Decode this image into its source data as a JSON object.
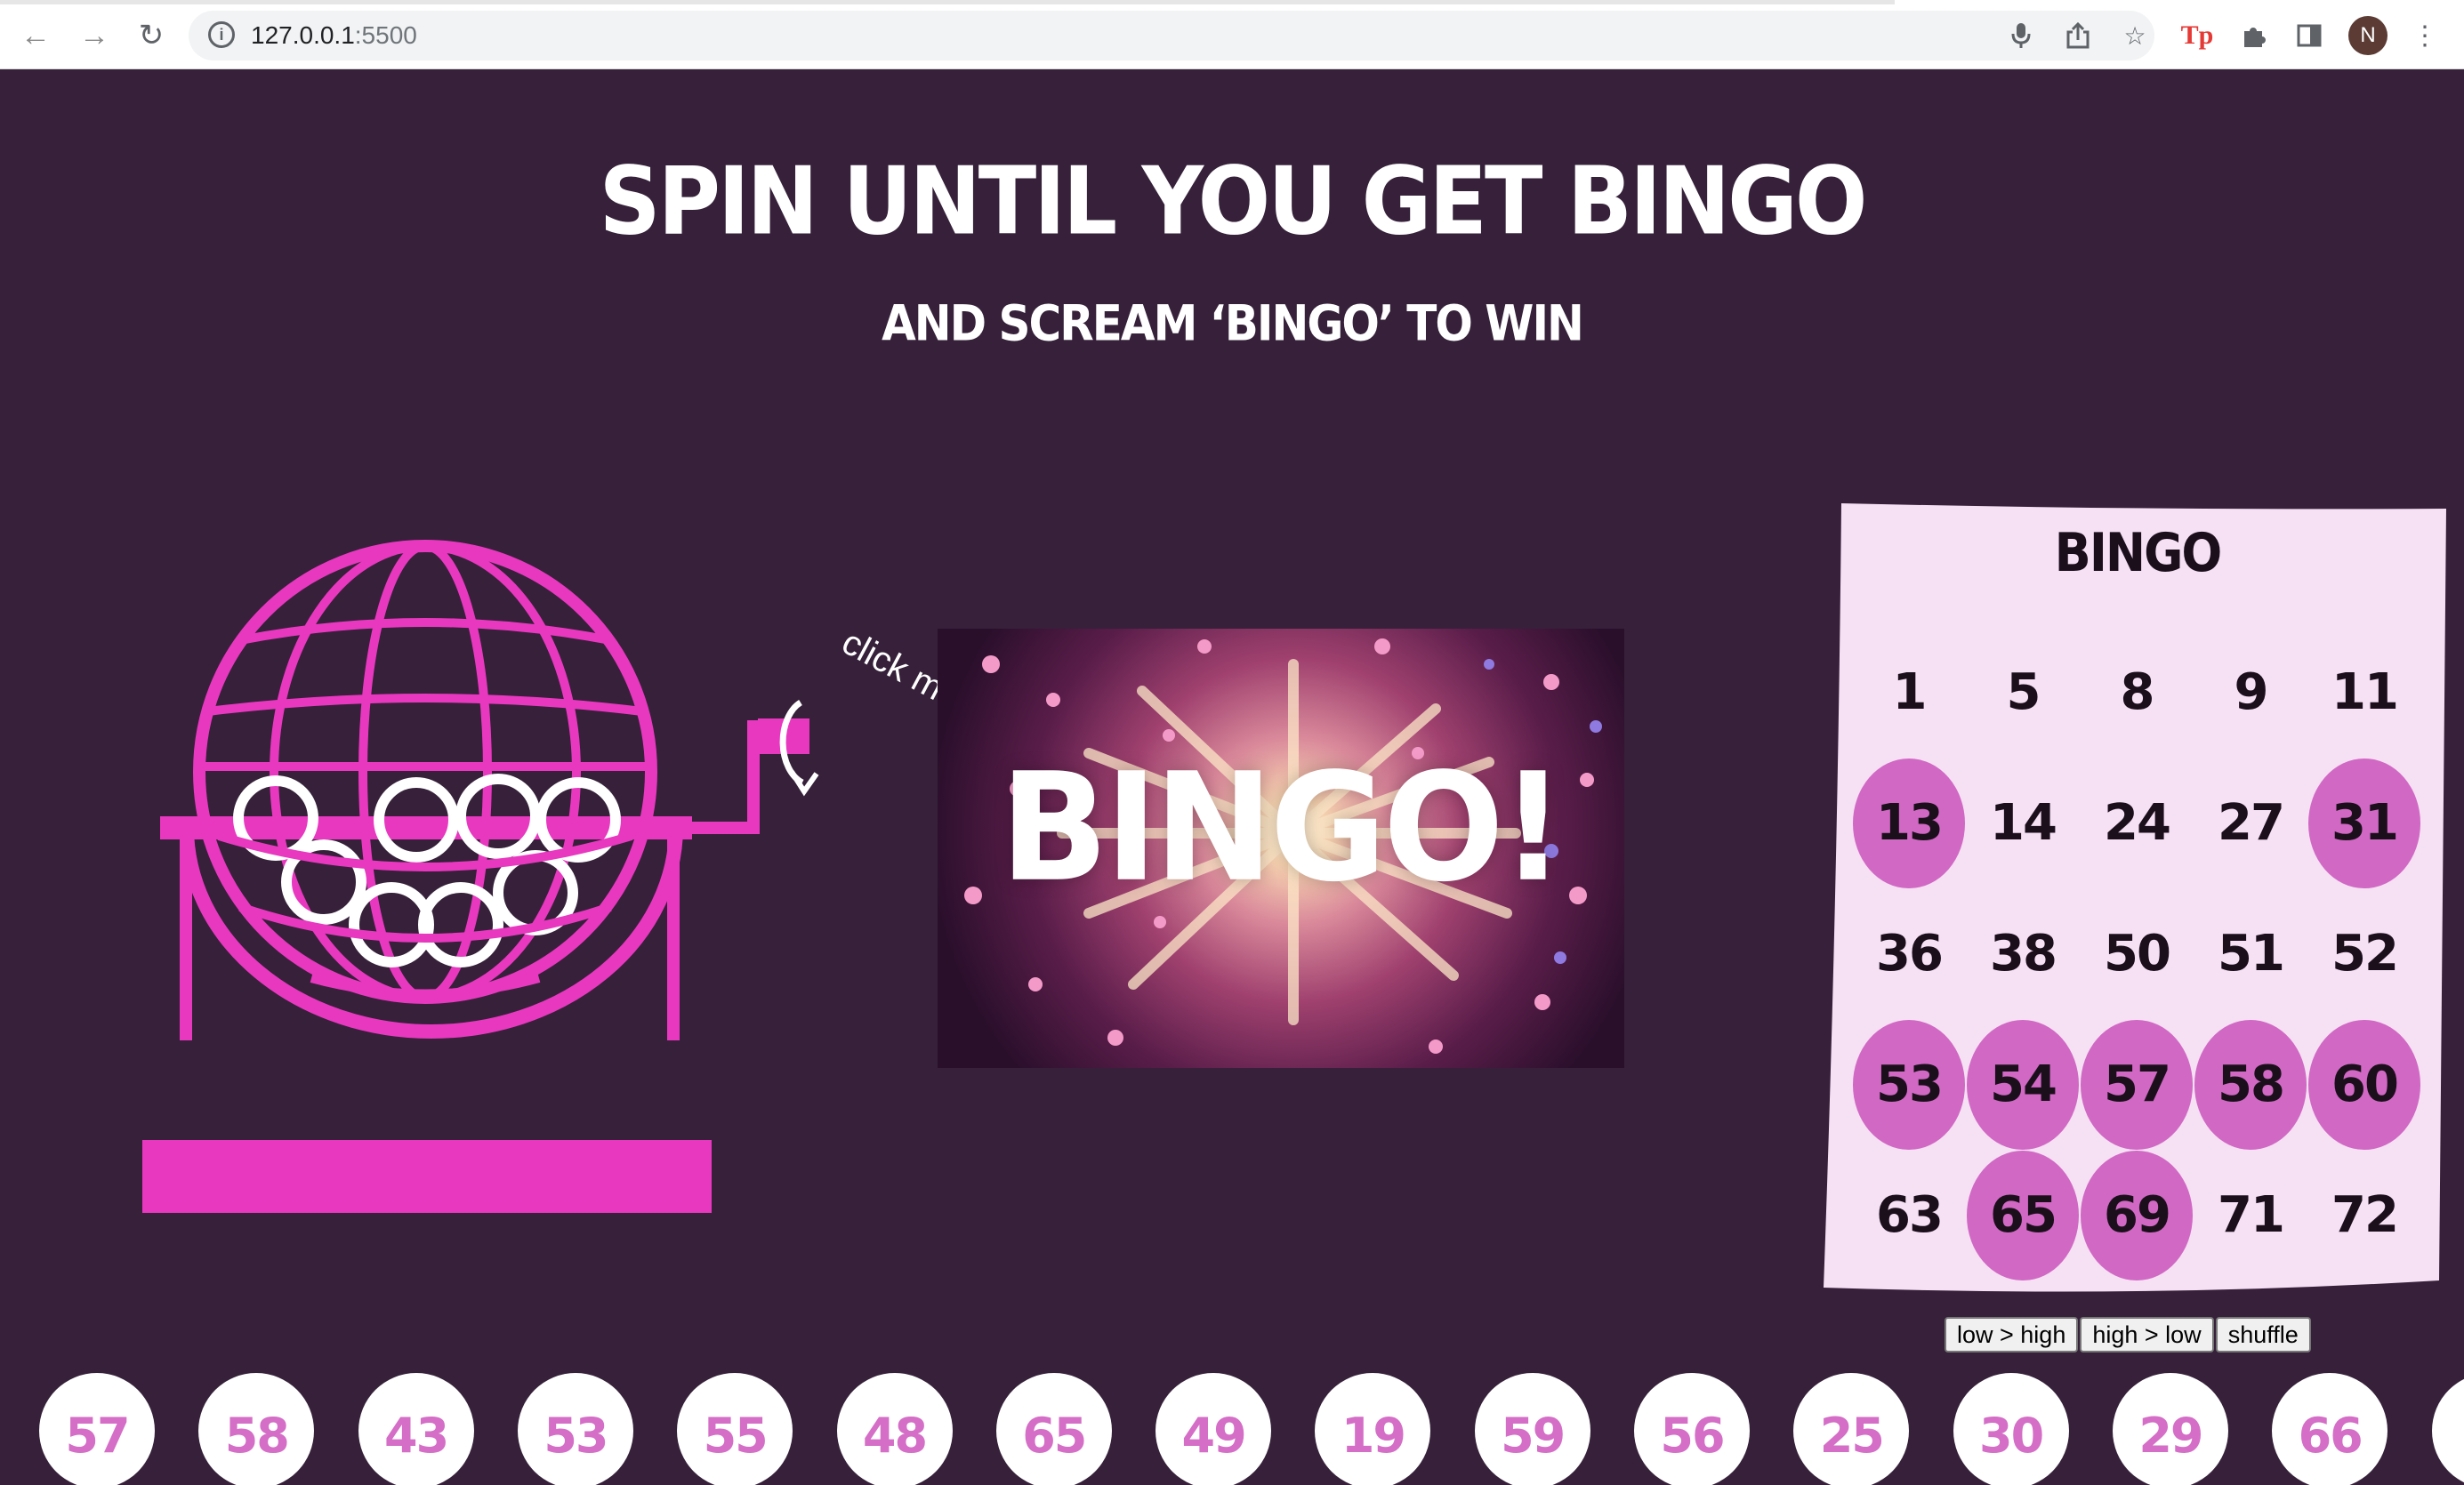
{
  "browser": {
    "url_host": "127.0.0.1",
    "url_port": ":5500",
    "avatar_initial": "N",
    "ext_tp_label": "Tp"
  },
  "page": {
    "title": "SPIN UNTIL YOU GET BINGO",
    "subtitle": "AND SCREAM ‘BINGO’ TO WIN",
    "handle_hint": "click m",
    "banner_text": "BINGO!"
  },
  "card": {
    "title": "BINGO",
    "numbers": [
      {
        "value": "1",
        "marked": false
      },
      {
        "value": "5",
        "marked": false
      },
      {
        "value": "8",
        "marked": false
      },
      {
        "value": "9",
        "marked": false
      },
      {
        "value": "11",
        "marked": false
      },
      {
        "value": "13",
        "marked": true
      },
      {
        "value": "14",
        "marked": false
      },
      {
        "value": "24",
        "marked": false
      },
      {
        "value": "27",
        "marked": false
      },
      {
        "value": "31",
        "marked": true
      },
      {
        "value": "36",
        "marked": false
      },
      {
        "value": "38",
        "marked": false
      },
      {
        "value": "50",
        "marked": false
      },
      {
        "value": "51",
        "marked": false
      },
      {
        "value": "52",
        "marked": false
      },
      {
        "value": "53",
        "marked": true
      },
      {
        "value": "54",
        "marked": true
      },
      {
        "value": "57",
        "marked": true
      },
      {
        "value": "58",
        "marked": true
      },
      {
        "value": "60",
        "marked": true
      },
      {
        "value": "63",
        "marked": false
      },
      {
        "value": "65",
        "marked": true
      },
      {
        "value": "69",
        "marked": true
      },
      {
        "value": "71",
        "marked": false
      },
      {
        "value": "72",
        "marked": false
      }
    ]
  },
  "sort_buttons": {
    "low_high": "low > high",
    "high_low": "high > low",
    "shuffle": "shuffle"
  },
  "drawn_balls": [
    "57",
    "58",
    "43",
    "53",
    "55",
    "48",
    "65",
    "49",
    "19",
    "59",
    "56",
    "25",
    "30",
    "29",
    "66",
    ""
  ],
  "colors": {
    "background": "#36203a",
    "accent_pink": "#e838bf",
    "marked": "#d068c4",
    "card": "#f6e0f4",
    "ball_text": "#d46ec6"
  }
}
